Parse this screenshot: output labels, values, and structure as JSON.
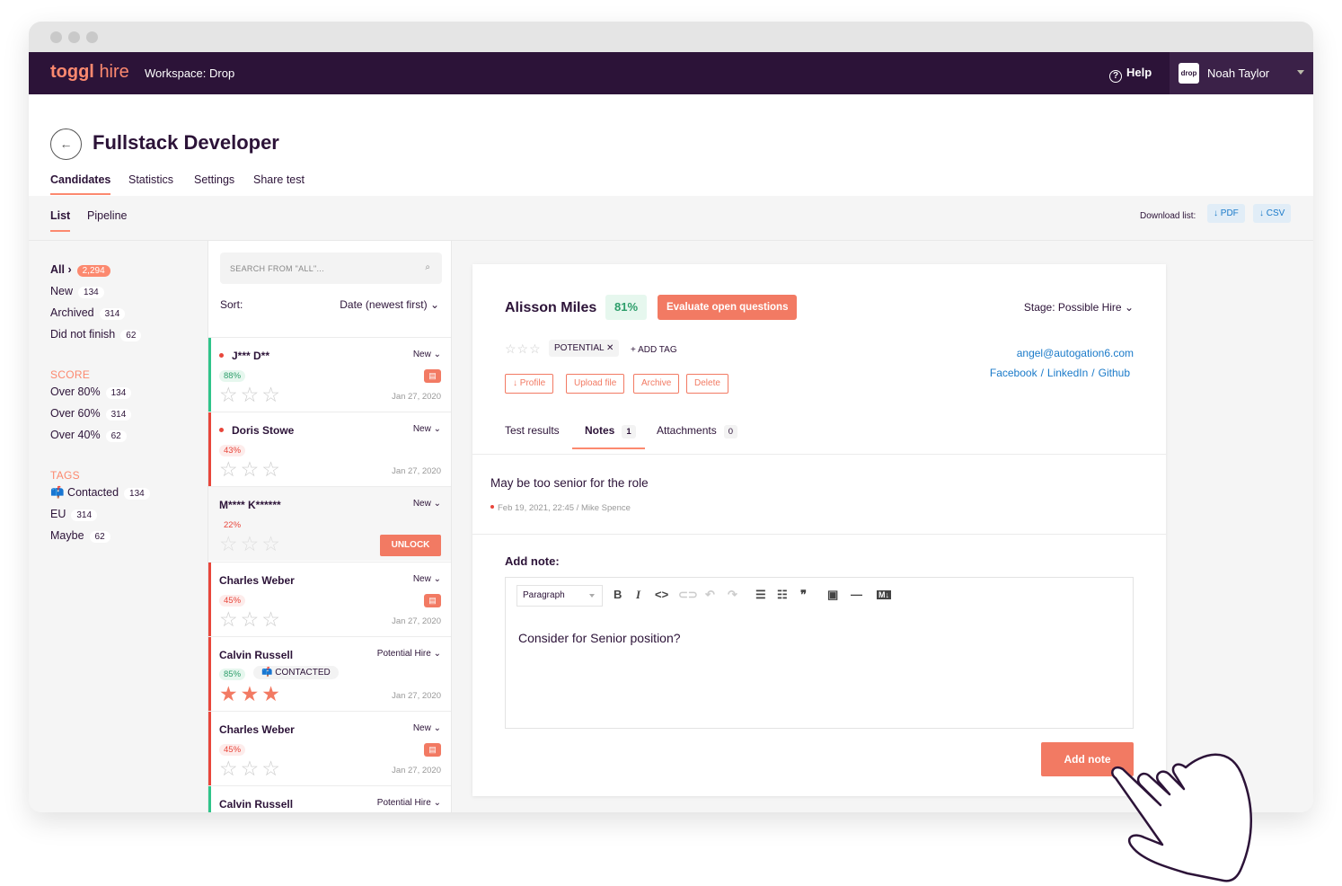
{
  "topbar": {
    "logo_toggl": "toggl",
    "logo_hire": "hire",
    "workspace": "Workspace: Drop",
    "help": "Help",
    "avatar_text": "drop",
    "user": "Noah Taylor"
  },
  "page": {
    "title": "Fullstack Developer",
    "tabs": [
      "Candidates",
      "Statistics",
      "Settings",
      "Share test"
    ]
  },
  "subnav": {
    "list": "List",
    "pipeline": "Pipeline",
    "download_label": "Download list:",
    "pdf": "PDF",
    "csv": "CSV"
  },
  "filters": {
    "all": {
      "label": "All ›",
      "count": "2,294"
    },
    "status": [
      {
        "label": "New",
        "count": "134"
      },
      {
        "label": "Archived",
        "count": "314"
      },
      {
        "label": "Did not finish",
        "count": "62"
      }
    ],
    "score_title": "SCORE",
    "score": [
      {
        "label": "Over 80%",
        "count": "134"
      },
      {
        "label": "Over 60%",
        "count": "314"
      },
      {
        "label": "Over 40%",
        "count": "62"
      }
    ],
    "tags_title": "TAGS",
    "tags": [
      {
        "label": "📫 Contacted",
        "count": "134"
      },
      {
        "label": "EU",
        "count": "314"
      },
      {
        "label": "Maybe",
        "count": "62"
      }
    ]
  },
  "list": {
    "search_placeholder": "SEARCH FROM \"ALL\"...",
    "sort_label": "Sort:",
    "sort_value": "Date (newest first)",
    "unlock": "UNLOCK",
    "contacted": "📫 CONTACTED",
    "cards": [
      {
        "name": "J*** D**",
        "stage": "New",
        "pct": "88%",
        "date": "Jan 27, 2020"
      },
      {
        "name": "Doris Stowe",
        "stage": "New",
        "pct": "43%",
        "date": "Jan 27, 2020"
      },
      {
        "name": "M**** K******",
        "stage": "New",
        "pct": "22%",
        "date": ""
      },
      {
        "name": "Charles Weber",
        "stage": "New",
        "pct": "45%",
        "date": "Jan 27, 2020"
      },
      {
        "name": "Calvin Russell",
        "stage": "Potential Hire",
        "pct": "85%",
        "date": "Jan 27, 2020"
      },
      {
        "name": "Charles Weber",
        "stage": "New",
        "pct": "45%",
        "date": "Jan 27, 2020"
      },
      {
        "name": "Calvin Russell",
        "stage": "Potential Hire",
        "pct": "",
        "date": ""
      }
    ]
  },
  "detail": {
    "name": "Alisson Miles",
    "score": "81%",
    "evaluate": "Evaluate open questions",
    "stage": "Stage: Possible Hire",
    "tag": "POTENTIAL",
    "add_tag": "+ ADD TAG",
    "email": "angel@autogation6.com",
    "facebook": "Facebook",
    "linkedin": "LinkedIn",
    "github": "Github",
    "actions": [
      "Profile",
      "Upload file",
      "Archive",
      "Delete"
    ],
    "tabs": [
      {
        "label": "Test results",
        "count": ""
      },
      {
        "label": "Notes",
        "count": "1"
      },
      {
        "label": "Attachments",
        "count": "0"
      }
    ],
    "note_text": "May be too senior for the role",
    "note_date": "Feb 19, 2021, 22:45",
    "note_author": "Mike Spence",
    "add_note_label": "Add note:",
    "paragraph": "Paragraph",
    "editor_text": "Consider for Senior position?",
    "add_note_button": "Add note"
  },
  "colors": {
    "brand": "#2c1338",
    "accent": "#f27a63",
    "link": "#1a7ac9",
    "green": "#2e9e6b"
  }
}
